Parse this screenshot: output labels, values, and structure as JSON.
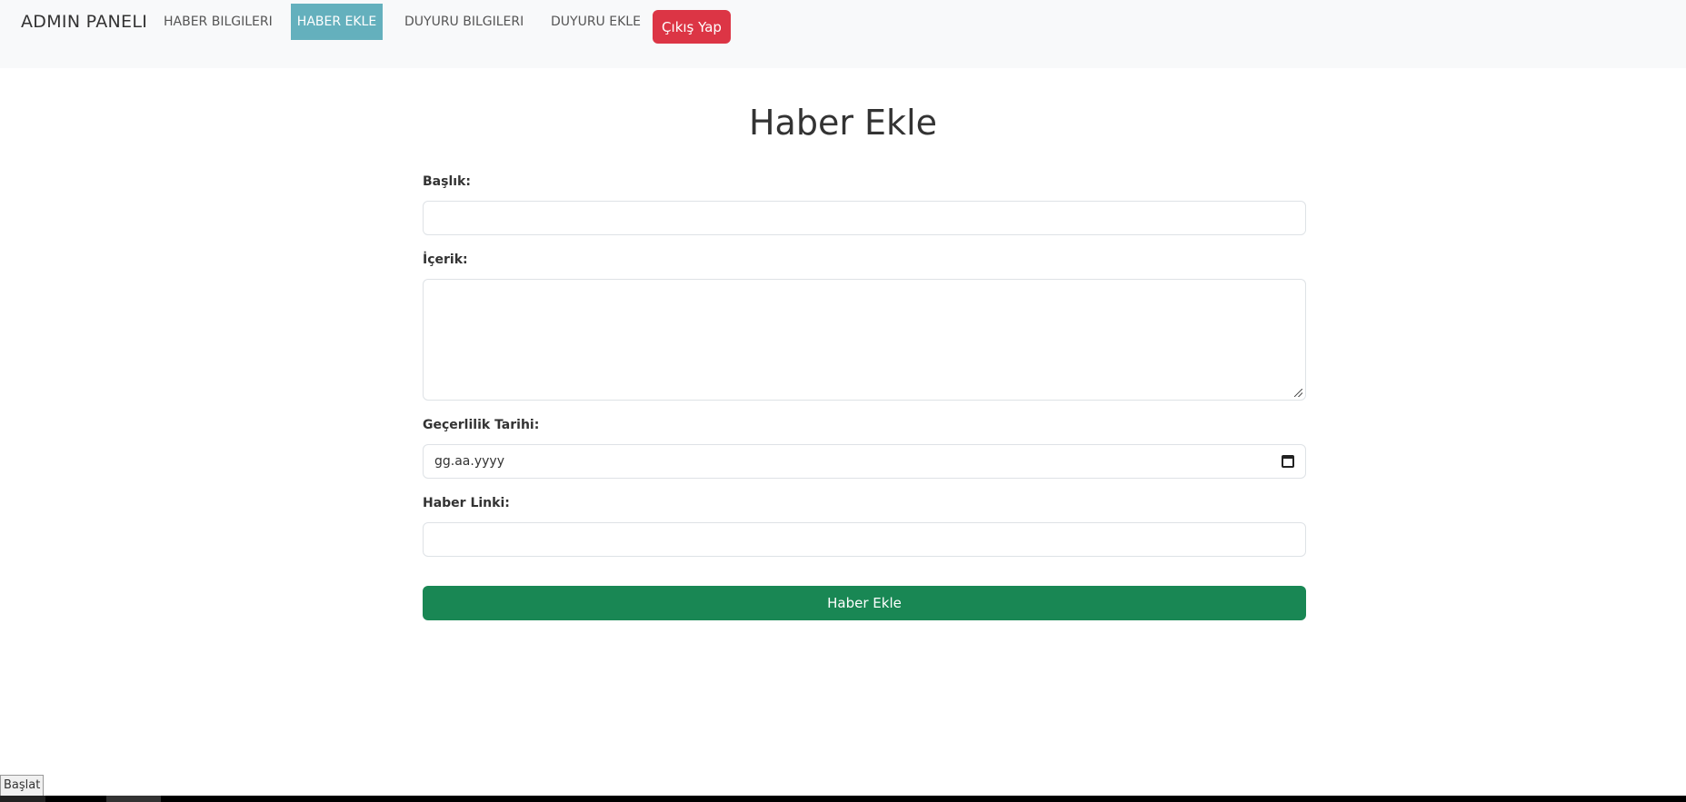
{
  "navbar": {
    "brand": "ADMIN PANELI",
    "items": [
      {
        "label": "HABER BILGILERI",
        "active": false
      },
      {
        "label": "HABER EKLE",
        "active": true
      },
      {
        "label": "DUYURU BILGILERI",
        "active": false
      },
      {
        "label": "DUYURU EKLE",
        "active": false
      }
    ],
    "logout_label": "Çıkış Yap"
  },
  "form": {
    "title": "Haber Ekle",
    "fields": {
      "baslik": {
        "label": "Başlık:",
        "value": ""
      },
      "icerik": {
        "label": "İçerik:",
        "value": ""
      },
      "tarih": {
        "label": "Geçerlilik Tarihi:",
        "placeholder": "gg.aa.yyyy"
      },
      "link": {
        "label": "Haber Linki:",
        "value": ""
      }
    },
    "submit_label": "Haber Ekle"
  },
  "status_badge": "Başlat",
  "colors": {
    "active_nav": "#64b0bd",
    "logout": "#dc3545",
    "submit": "#198754",
    "navbar_bg": "#f8f9fa"
  }
}
